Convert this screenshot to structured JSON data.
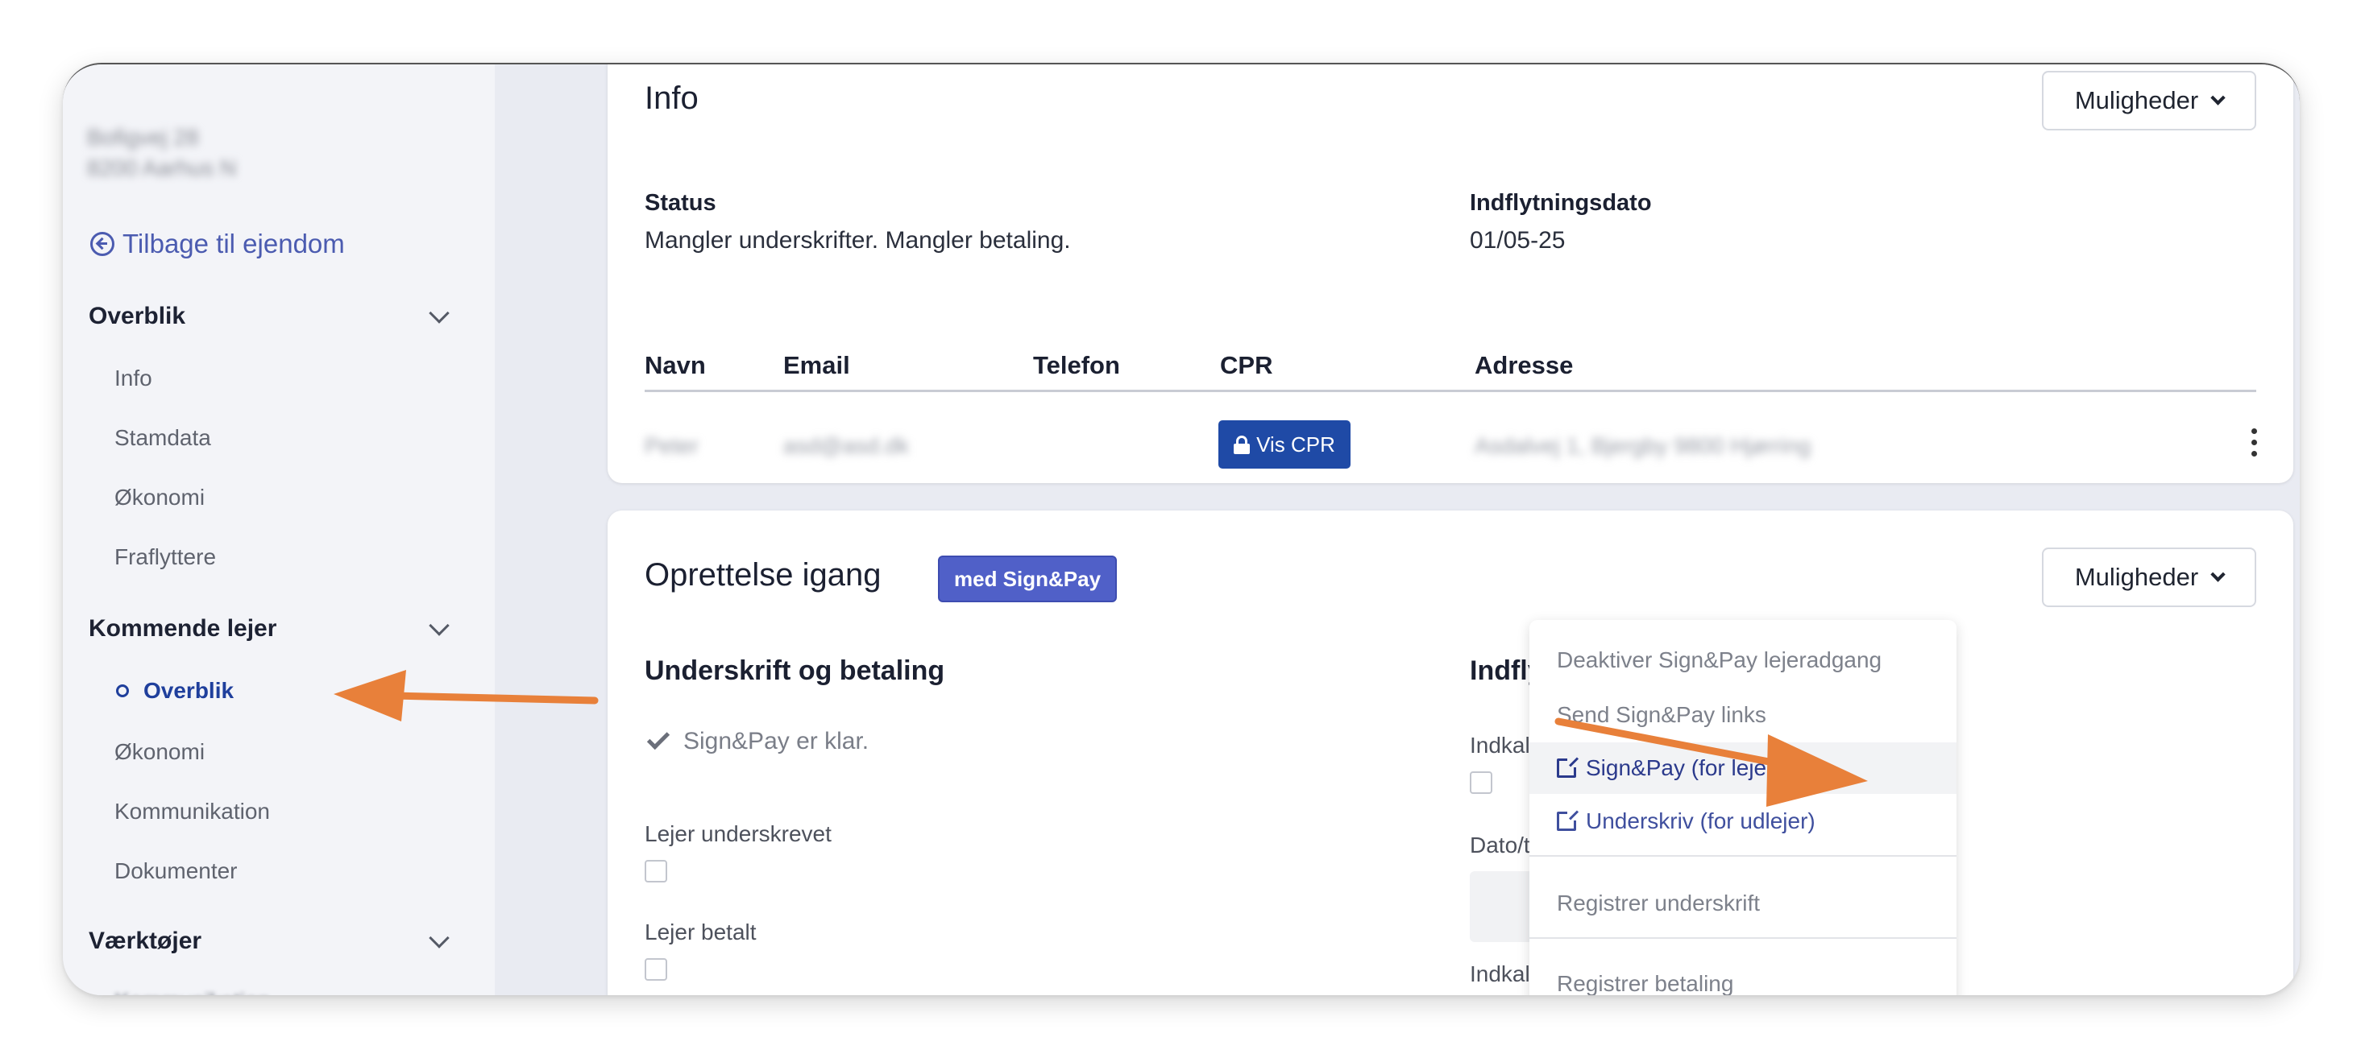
{
  "sidebar": {
    "address_line1": "Bofigvej 28",
    "address_line2": "8200 Aarhus N",
    "back_link": "Tilbage til ejendom",
    "sections": {
      "overblik": "Overblik",
      "kommende": "Kommende lejer",
      "vaerktoejer": "Værktøjer"
    },
    "overblik_items": [
      "Info",
      "Stamdata",
      "Økonomi",
      "Fraflyttere"
    ],
    "kommende_items": [
      "Overblik",
      "Økonomi",
      "Kommunikation",
      "Dokumenter"
    ],
    "cut_item": "Kommunikation"
  },
  "info_card": {
    "title": "Info",
    "options_label": "Muligheder",
    "status_label": "Status",
    "status_value": "Mangler underskrifter. Mangler betaling.",
    "date_label": "Indflytningsdato",
    "date_value": "01/05-25",
    "columns": [
      "Navn",
      "Email",
      "Telefon",
      "CPR",
      "Adresse"
    ],
    "row": {
      "name": "Peter",
      "email": "asd@asd.dk",
      "cpr_button": "Vis CPR",
      "address": "Asdalvej 1, Bjergby 9800 Hjørring"
    }
  },
  "setup_card": {
    "title": "Oprettelse igang",
    "badge": "med Sign&Pay",
    "options_label": "Muligheder",
    "left_heading": "Underskrift og betaling",
    "ready_text": "Sign&Pay er klar.",
    "tenant_signed": "Lejer underskrevet",
    "tenant_paid": "Lejer betalt",
    "right_heading": "Indflytning",
    "invite_label": "Indkaldelse til indflytningssyn",
    "datetime_label": "Dato/tid for indflytningssyn",
    "accepted_label": "Indkaldelse accepteret af lejer"
  },
  "menu": {
    "items": [
      "Deaktiver Sign&Pay lejeradgang",
      "Send Sign&Pay links",
      "Sign&Pay (for lejer)",
      "Underskriv (for udlejer)",
      "Registrer underskrift",
      "Registrer betaling"
    ]
  },
  "colors": {
    "accent": "#1f4aa6",
    "badge": "#5060c8",
    "arrow": "#e8803a",
    "sidebar_bg": "#f3f4f8"
  }
}
